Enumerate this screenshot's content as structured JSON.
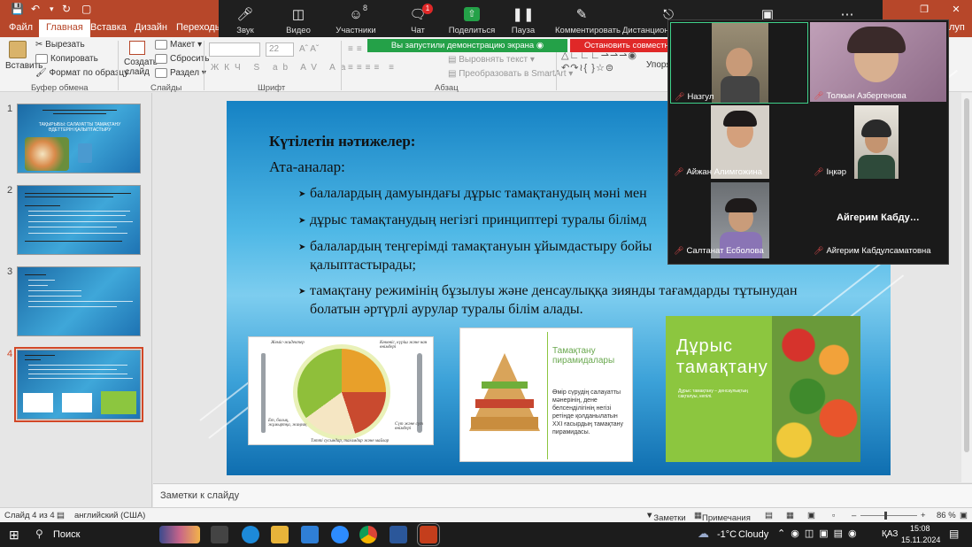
{
  "titlebar": {
    "save_icon": "save-icon",
    "undo_icon": "undo-icon"
  },
  "tabs": [
    "Файл",
    "Главная",
    "Вставка",
    "Дизайн",
    "Переходы"
  ],
  "tabs_right": "луп",
  "zoom_toolbar": {
    "items": [
      {
        "label": "Звук",
        "icon": "microphone-icon"
      },
      {
        "label": "Видео",
        "icon": "video-camera-icon"
      },
      {
        "label": "Участники",
        "icon": "participants-icon",
        "badge": "8"
      },
      {
        "label": "Чат",
        "icon": "chat-icon",
        "badge": "1"
      },
      {
        "label": "Поделиться",
        "icon": "share-icon"
      },
      {
        "label": "Пауза",
        "icon": "pause-icon"
      },
      {
        "label": "Комментировать",
        "icon": "annotate-icon"
      },
      {
        "label": "Дистанционн",
        "icon": "remote-control-icon"
      }
    ],
    "share_notice": "Вы запустили демонстрацию экрана",
    "stop_share": "Остановить совместное"
  },
  "ribbon": {
    "paste": "Вставить",
    "cut": "Вырезать",
    "copy": "Копировать",
    "format_painter": "Формат по образцу",
    "clipboard_group": "Буфер обмена",
    "new_slide": "Создать слайд",
    "layout": "Макет",
    "reset": "Сбросить",
    "section": "Раздел",
    "slides_group": "Слайды",
    "font_size": "22",
    "font_group": "Шрифт",
    "text_align": "Выровнять текст",
    "smartart": "Преобразовать в SmartArt",
    "paragraph_group": "Абзац",
    "arrange": "Упоря"
  },
  "thumbnails": [
    {
      "num": "1",
      "title": "ТАҚЫРЫБЫ: САЛАУАТТЫ ТАМАҚТАНУ ӘДЕТТЕРІН ҚАЛЫПТАСТЫРУ"
    },
    {
      "num": "2"
    },
    {
      "num": "3"
    },
    {
      "num": "4",
      "selected": true
    }
  ],
  "slide": {
    "heading": "Күтілетін нәтижелер:",
    "subheading": "Ата-аналар:",
    "bullets": [
      "балалардың дамуындағы дұрыс тамақтанудың мәні мен",
      "дұрыс тамақтанудың негізгі принциптері туралы білімд",
      "балалардың теңгерімді тамақтануын ұйымдастыру бойы",
      "қалыптастырады;",
      "тамақтану режимінің бұзылуы және денсаулыққа зиянды тағамдарды тұтынудан",
      "болатын әртүрлі аурулар туралы білім алады."
    ],
    "plate_labels": [
      "Жеміс-жидектер",
      "Көкөніс, күріш және нан өнімдері",
      "Ет, балық, жұмыртқа, жаңғақ",
      "Сүт және сүт өнімдері",
      "Тәтті сусындар, тағамдар және майлар"
    ],
    "pyramid_title": "Тамақтану пирамидалары",
    "pyramid_text": "Өмір сүрудің салауатты мәнерінің, дене белсенділігінің негізі ретінде қолданылатын XXI ғасырдың тамақтану пирамидасы.",
    "veg_title": "Дұрыс тамақтану",
    "veg_text": "Дұрыс тамақтану – денсаулықтың сақталуы, кепілі."
  },
  "notes_placeholder": "Заметки к слайду",
  "status": {
    "slide_info": "Слайд 4 из 4",
    "language": "английский (США)",
    "notes": "Заметки",
    "comments": "Примечания",
    "zoom": "86 %"
  },
  "video_tiles": [
    {
      "name": "Назгул"
    },
    {
      "name": "Толкын Азбергенова"
    },
    {
      "name": "Айжан Алимгожина"
    },
    {
      "name": "Іңкәр"
    },
    {
      "name": "Салтанат Есболова"
    },
    {
      "name": "Айгерим Кабдулсаматовна",
      "display": "Айгерим  Кабду…"
    }
  ],
  "taskbar": {
    "search": "Поиск",
    "weather_temp": "-1°C",
    "weather_text": "Cloudy",
    "lang": "ҚАЗ",
    "time": "15:08",
    "date": "15.11.2024"
  },
  "colors": {
    "accent": "#b7472a",
    "share_green": "#24a148",
    "stop_red": "#e02828",
    "selection": "#d24726"
  }
}
